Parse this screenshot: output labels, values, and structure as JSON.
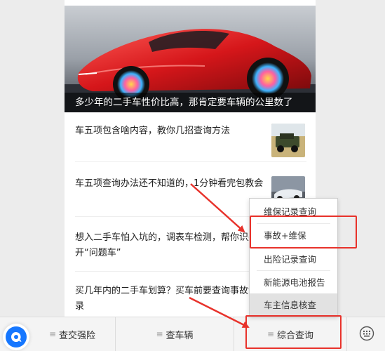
{
  "hero": {
    "caption": "多少年的二手车性价比高，那肯定要车辆的公里数了"
  },
  "articles": [
    {
      "title": "车五项包含啥内容，教你几招查询方法"
    },
    {
      "title": "车五项查询办法还不知道的，1分钟看完包教会"
    },
    {
      "title": "想入二手车怕入坑的，调表车检测，帮你识别开“问题车”"
    },
    {
      "title": "买几年内的二手车划算？买车前要查询事故记录"
    }
  ],
  "menu": {
    "items": [
      {
        "label": "维保记录查询"
      },
      {
        "label": "事故+维保"
      },
      {
        "label": "出险记录查询"
      },
      {
        "label": "新能源电池报告"
      },
      {
        "label": "车主信息核查"
      }
    ]
  },
  "bottom_bar": {
    "tabs": [
      {
        "label": "查交强险"
      },
      {
        "label": "查车辆"
      },
      {
        "label": "综合查询"
      }
    ],
    "lines_glyph": "≡"
  },
  "colors": {
    "annotation_red": "#e8322b",
    "chat_blue": "#1677ff"
  }
}
